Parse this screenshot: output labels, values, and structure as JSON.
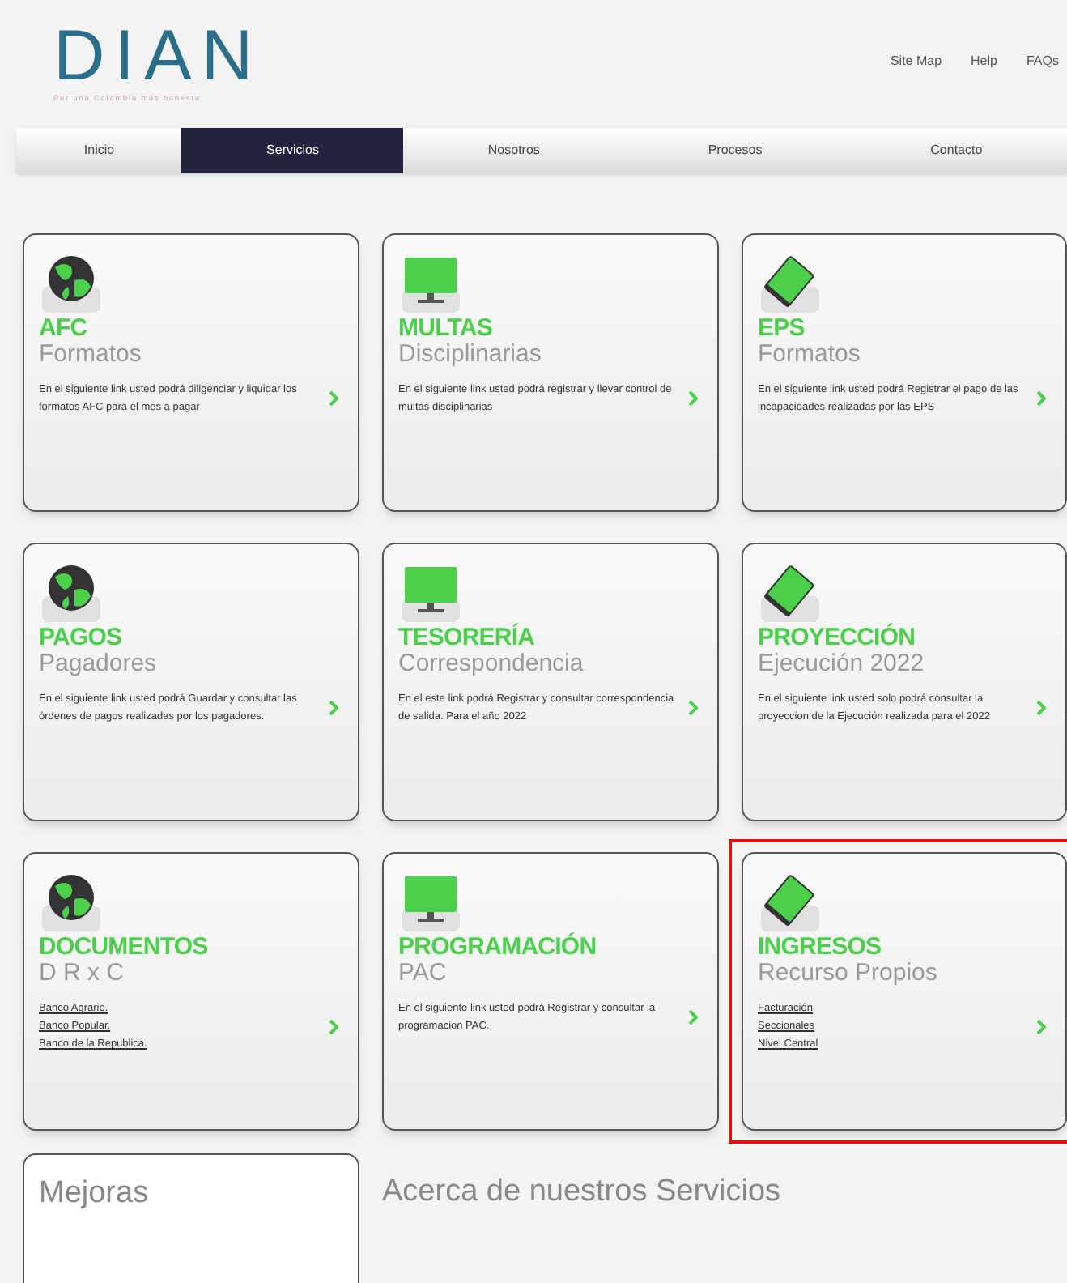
{
  "header": {
    "logo": "DIAN",
    "tagline": "Por una Colombia más honesta",
    "links": [
      "Site Map",
      "Help",
      "FAQs"
    ]
  },
  "nav": [
    {
      "label": "Inicio",
      "selected": false
    },
    {
      "label": "Servicios",
      "selected": true
    },
    {
      "label": "Nosotros",
      "selected": false
    },
    {
      "label": "Procesos",
      "selected": false
    },
    {
      "label": "Contacto",
      "selected": false
    }
  ],
  "cards": [
    {
      "kind": "globe",
      "title": "AFC",
      "subtitle": "Formatos",
      "body": "En el siguiente link usted podrá diligenciar y liquidar los formatos AFC para el mes a pagar",
      "highlighted": false
    },
    {
      "kind": "monitor",
      "title": "MULTAS",
      "subtitle": "Disciplinarias",
      "body": "En el siguiente link usted podrá registrar y llevar control de multas disciplinarias",
      "highlighted": false
    },
    {
      "kind": "device",
      "title": "EPS",
      "subtitle": "Formatos",
      "body": "En el siguiente link usted podrá Registrar el pago de las incapacidades realizadas por las EPS",
      "highlighted": false
    },
    {
      "kind": "globe",
      "title": "PAGOS",
      "subtitle": "Pagadores",
      "body": "En el siguiente link usted podrá Guardar y consultar las órdenes de pagos realizadas por los pagadores.",
      "highlighted": false
    },
    {
      "kind": "monitor",
      "title": "TESORERÍA",
      "subtitle": "Correspondencia",
      "body": "En el este link podrá Registrar y consultar correspondencia de salida. Para el año 2022",
      "highlighted": false
    },
    {
      "kind": "device",
      "title": "PROYECCIÓN",
      "subtitle": "Ejecución 2022",
      "body": "En el siguiente link usted solo podrá consultar la proyeccion de la Ejecución realizada para el 2022",
      "highlighted": false
    },
    {
      "kind": "globe",
      "title": "DOCUMENTOS",
      "subtitle": "D R x C",
      "links": [
        "Banco Agrario.",
        "Banco Popular.",
        "Banco de la Republica."
      ],
      "highlighted": false
    },
    {
      "kind": "monitor",
      "title": "PROGRAMACIÓN",
      "subtitle": "PAC",
      "body": "En el siguiente link usted podrá Registrar y consultar la programacion PAC.",
      "highlighted": false
    },
    {
      "kind": "device",
      "title": "INGRESOS",
      "subtitle": "Recurso Propios",
      "links": [
        "Facturación",
        "Seccionales",
        "Nivel Central"
      ],
      "highlighted": true
    }
  ],
  "bottom": {
    "card_title": "Mejoras",
    "heading": "Acerca de nuestros Servicios"
  }
}
